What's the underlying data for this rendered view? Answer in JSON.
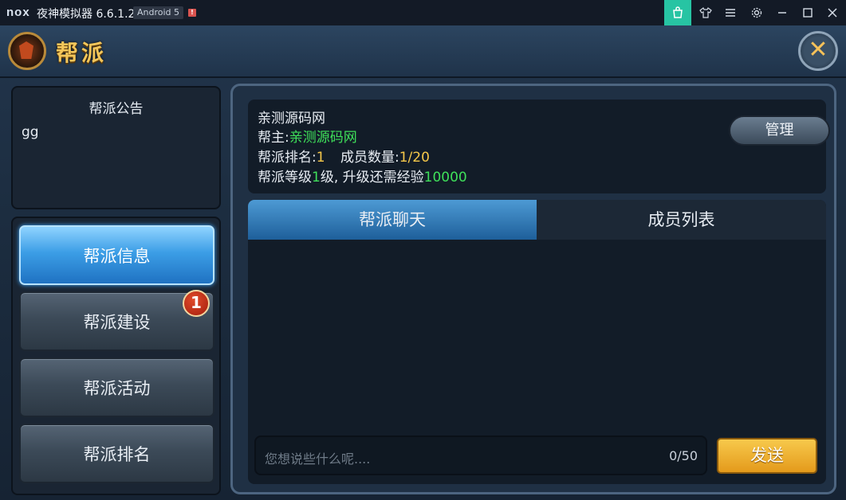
{
  "window": {
    "logo": "nox",
    "title": "夜神模拟器 6.6.1.2",
    "android": "Android 5",
    "warn": "!"
  },
  "titlebar_buttons": [
    "store-icon",
    "shirt-icon",
    "menu-icon",
    "gear-icon",
    "minimize-icon",
    "maximize-icon",
    "close-icon"
  ],
  "header": {
    "title": "帮派",
    "close": "✕"
  },
  "notice": {
    "title": "帮派公告",
    "body": "gg"
  },
  "menu": {
    "items": [
      "帮派信息",
      "帮派建设",
      "帮派活动",
      "帮派排名"
    ],
    "active_index": 0,
    "badge": "1"
  },
  "info": {
    "name": "亲测源码网",
    "leader_label": "帮主:",
    "leader": "亲测源码网",
    "rank_label": "帮派排名:",
    "rank": "1",
    "members_label": "成员数量:",
    "members": "1/20",
    "level_prefix": "帮派等级",
    "level": "1",
    "level_mid": "级, 升级还需经验",
    "exp_needed": "10000",
    "manage_label": "管理"
  },
  "tabs": {
    "chat": "帮派聊天",
    "members": "成员列表"
  },
  "chat": {
    "placeholder": "您想说些什么呢....",
    "count": "0/50",
    "send": "发送"
  },
  "colors": {
    "accent": "#3c9ee6",
    "gold": "#f3c65a",
    "green": "#3fe05a",
    "yellow": "#f6c84a",
    "badge": "#a41e0c"
  }
}
